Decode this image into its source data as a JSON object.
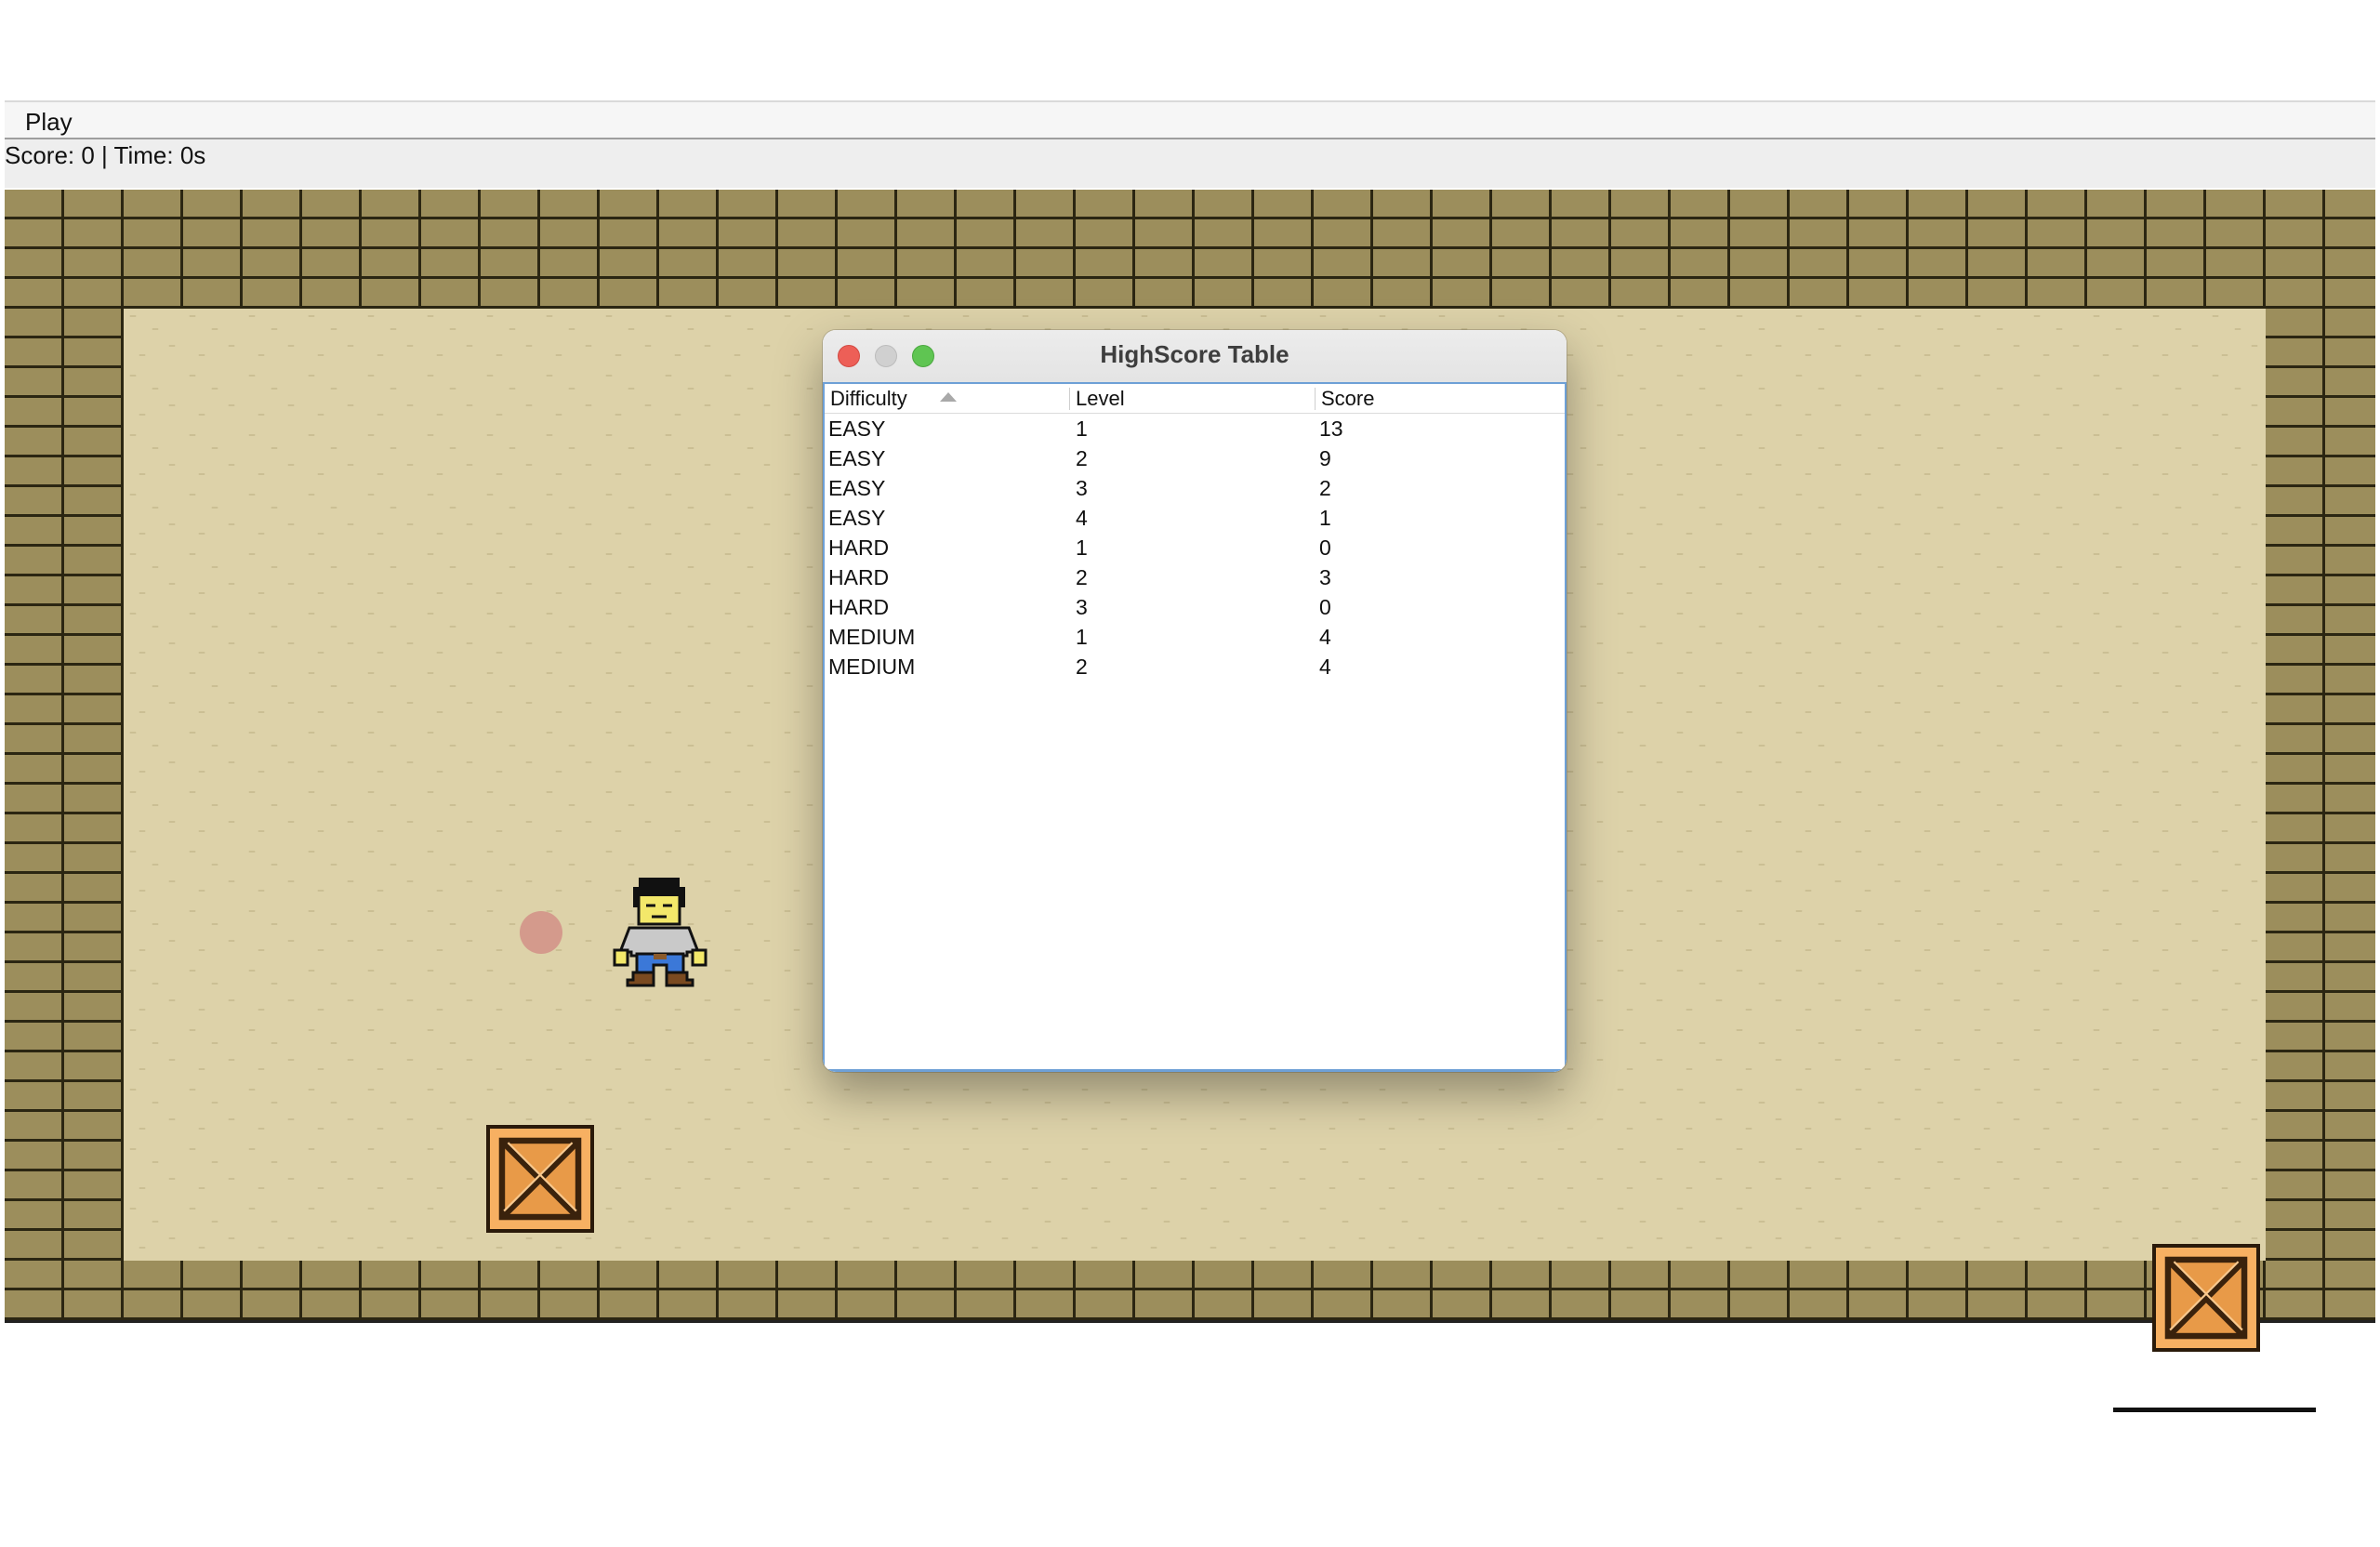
{
  "menu": {
    "items": [
      {
        "label": "Play"
      }
    ]
  },
  "status": {
    "text": "Score: 0 | Time: 0s"
  },
  "game": {
    "colors": {
      "wall": "#9c8e5c",
      "mortar": "#2b2612",
      "floor": "#ddd2a9",
      "crate": "#f7b062",
      "goal": "#d49a8c"
    },
    "crates": [
      {
        "name": "crate-top",
        "icon": "crate-icon"
      },
      {
        "name": "crate-left",
        "icon": "crate-icon"
      },
      {
        "name": "crate-right",
        "icon": "crate-icon"
      }
    ],
    "player": {
      "icon": "player-sprite"
    },
    "goal": {
      "icon": "goal-dot"
    }
  },
  "dialog": {
    "title": "HighScore Table",
    "window_buttons": [
      "close",
      "minimize",
      "zoom"
    ],
    "table": {
      "columns": [
        "Difficulty",
        "Level",
        "Score"
      ],
      "sorted_by": "Difficulty",
      "sort_direction": "ascending",
      "rows": [
        [
          "EASY",
          "1",
          "13"
        ],
        [
          "EASY",
          "2",
          "9"
        ],
        [
          "EASY",
          "3",
          "2"
        ],
        [
          "EASY",
          "4",
          "1"
        ],
        [
          "HARD",
          "1",
          "0"
        ],
        [
          "HARD",
          "2",
          "3"
        ],
        [
          "HARD",
          "3",
          "0"
        ],
        [
          "MEDIUM",
          "1",
          "4"
        ],
        [
          "MEDIUM",
          "2",
          "4"
        ]
      ]
    }
  }
}
